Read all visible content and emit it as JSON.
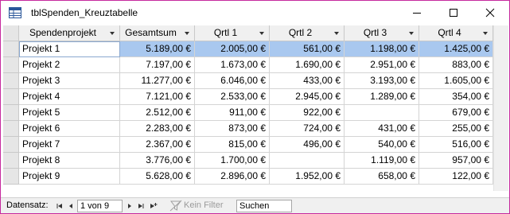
{
  "window": {
    "title": "tblSpenden_Kreuztabelle"
  },
  "table": {
    "columns": [
      "Spendenprojekt",
      "Gesamtsum",
      "Qrtl 1",
      "Qrtl 2",
      "Qrtl 3",
      "Qrtl 4"
    ],
    "rows": [
      [
        "Projekt 1",
        "5.189,00 €",
        "2.005,00 €",
        "561,00 €",
        "1.198,00 €",
        "1.425,00 €"
      ],
      [
        "Projekt 2",
        "7.197,00 €",
        "1.673,00 €",
        "1.690,00 €",
        "2.951,00 €",
        "883,00 €"
      ],
      [
        "Projekt 3",
        "11.277,00 €",
        "6.046,00 €",
        "433,00 €",
        "3.193,00 €",
        "1.605,00 €"
      ],
      [
        "Projekt 4",
        "7.121,00 €",
        "2.533,00 €",
        "2.945,00 €",
        "1.289,00 €",
        "354,00 €"
      ],
      [
        "Projekt 5",
        "2.512,00 €",
        "911,00 €",
        "922,00 €",
        "",
        "679,00 €"
      ],
      [
        "Projekt 6",
        "2.283,00 €",
        "873,00 €",
        "724,00 €",
        "431,00 €",
        "255,00 €"
      ],
      [
        "Projekt 7",
        "2.367,00 €",
        "815,00 €",
        "496,00 €",
        "540,00 €",
        "516,00 €"
      ],
      [
        "Projekt 8",
        "3.776,00 €",
        "1.700,00 €",
        "",
        "1.119,00 €",
        "957,00 €"
      ],
      [
        "Projekt 9",
        "5.628,00 €",
        "2.896,00 €",
        "1.952,00 €",
        "658,00 €",
        "122,00 €"
      ]
    ],
    "selected_row": 0
  },
  "statusbar": {
    "record_label": "Datensatz:",
    "position": "1 von 9",
    "filter_label": "Kein Filter",
    "search_placeholder": "Suchen"
  },
  "colors": {
    "window_border": "#c62a9e",
    "selection": "#a9c8ef",
    "header_bg": "#f0f0f0"
  }
}
